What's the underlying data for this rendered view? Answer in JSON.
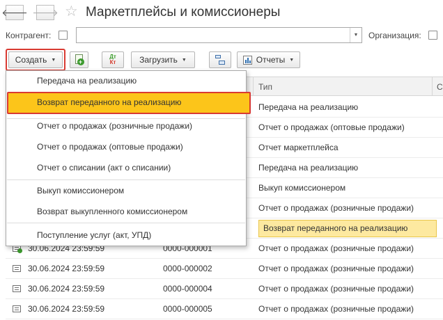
{
  "header": {
    "title": "Маркетплейсы и комиссионеры",
    "back_glyph": "🡐",
    "forward_glyph": "🡒",
    "star_glyph": "☆"
  },
  "filters": {
    "counterparty_label": "Контрагент:",
    "organization_label": "Организация:"
  },
  "toolbar": {
    "create_label": "Создать",
    "load_label": "Загрузить",
    "reports_label": "Отчеты",
    "dtkt_top": "Дт",
    "dtkt_bottom": "Кт"
  },
  "table": {
    "columns": {
      "type": "Тип",
      "next_partial": "С"
    },
    "rows_behind_menu": [
      {
        "type": "Передача на реализацию"
      },
      {
        "type": "Отчет о продажах (оптовые продажи)"
      },
      {
        "type": "Отчет маркетплейса"
      },
      {
        "type": "Передача на реализацию"
      },
      {
        "type": "Выкуп комиссионером"
      },
      {
        "type": "Отчет о продажах (розничные продажи)"
      },
      {
        "type": "Возврат переданного на реализацию",
        "highlighted": true
      }
    ],
    "rows": [
      {
        "date": "30.06.2024 23:59:59",
        "number": "0000-000001",
        "type": "Отчет о продажах (розничные продажи)",
        "posted": true
      },
      {
        "date": "30.06.2024 23:59:59",
        "number": "0000-000002",
        "type": "Отчет о продажах (розничные продажи)",
        "posted": false
      },
      {
        "date": "30.06.2024 23:59:59",
        "number": "0000-000004",
        "type": "Отчет о продажах (розничные продажи)",
        "posted": false
      },
      {
        "date": "30.06.2024 23:59:59",
        "number": "0000-000005",
        "type": "Отчет о продажах (розничные продажи)",
        "posted": false
      }
    ]
  },
  "create_menu": {
    "items": [
      "Передача на реализацию",
      "Возврат переданного на реализацию",
      "Отчет о продажах (розничные продажи)",
      "Отчет о продажах (оптовые продажи)",
      "Отчет о списании (акт о списании)",
      "Выкуп комиссионером",
      "Возврат выкупленного комиссионером",
      "Поступление услуг (акт, УПД)"
    ],
    "highlighted_index": 1
  },
  "colors": {
    "highlight_fill": "#fcc51a",
    "annotation_red": "#d93a32",
    "row_highlight": "#fde9a0"
  }
}
